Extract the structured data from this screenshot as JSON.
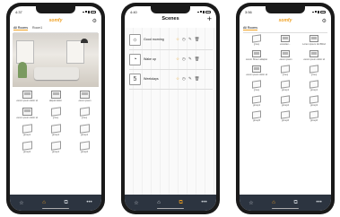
{
  "phone1": {
    "time": "4:37",
    "brand": "somfy",
    "tabs": [
      "All Rooms",
      "Room1"
    ],
    "devices": [
      {
        "label": "Lorem ipsum dolor sit",
        "type": "blind"
      },
      {
        "label": "aliquid dolor",
        "type": "blind"
      },
      {
        "label": "Lorem ipsum",
        "type": "blind"
      },
      {
        "label": "Lorem ipsum dolor sit",
        "type": "blind"
      },
      {
        "label": "group",
        "type": "box"
      },
      {
        "label": "group",
        "type": "box"
      },
      {
        "label": "group1",
        "type": "box"
      },
      {
        "label": "group1",
        "type": "box"
      },
      {
        "label": "group1",
        "type": "box"
      },
      {
        "label": "group2",
        "type": "box"
      },
      {
        "label": "group1",
        "type": "box"
      },
      {
        "label": "group2",
        "type": "box"
      }
    ]
  },
  "phone2": {
    "time": "4:40",
    "title": "Scenes",
    "scenes": [
      {
        "name": "Good morning",
        "icon": "sunrise-icon",
        "glyph": "☼"
      },
      {
        "name": "Wake up",
        "icon": "alarm-icon",
        "glyph": "◔"
      },
      {
        "name": "Weekdays",
        "icon": "number-five-icon",
        "glyph": "5"
      }
    ]
  },
  "phone3": {
    "time": "3:56",
    "brand": "somfy",
    "tabs": [
      "All Rooms"
    ],
    "devices": [
      {
        "label": "group",
        "type": "box"
      },
      {
        "label": "venetian...",
        "type": "blind"
      },
      {
        "label": "Lorem ipsum dol Blind",
        "type": "blind"
      },
      {
        "label": "Lorem Sheer adapter",
        "type": "blind"
      },
      {
        "label": "Lorem ipsum",
        "type": "blind"
      },
      {
        "label": "Lorem ipsum dolor sit",
        "type": "blind"
      },
      {
        "label": "Lorem ipsum dolor sit",
        "type": "blind"
      },
      {
        "label": "group",
        "type": "box"
      },
      {
        "label": "group",
        "type": "box"
      },
      {
        "label": "group",
        "type": "box"
      },
      {
        "label": "group1",
        "type": "box"
      },
      {
        "label": "group1",
        "type": "box"
      },
      {
        "label": "group1",
        "type": "box"
      },
      {
        "label": "group2",
        "type": "box"
      },
      {
        "label": "group3",
        "type": "box"
      },
      {
        "label": "group5",
        "type": "box"
      },
      {
        "label": "group6",
        "type": "box"
      },
      {
        "label": "group6",
        "type": "box"
      }
    ]
  },
  "nav": [
    "star-icon",
    "home-icon",
    "scenes-icon",
    "more-icon"
  ],
  "colors": {
    "accent": "#f0a020",
    "navbar": "#2c3440"
  }
}
